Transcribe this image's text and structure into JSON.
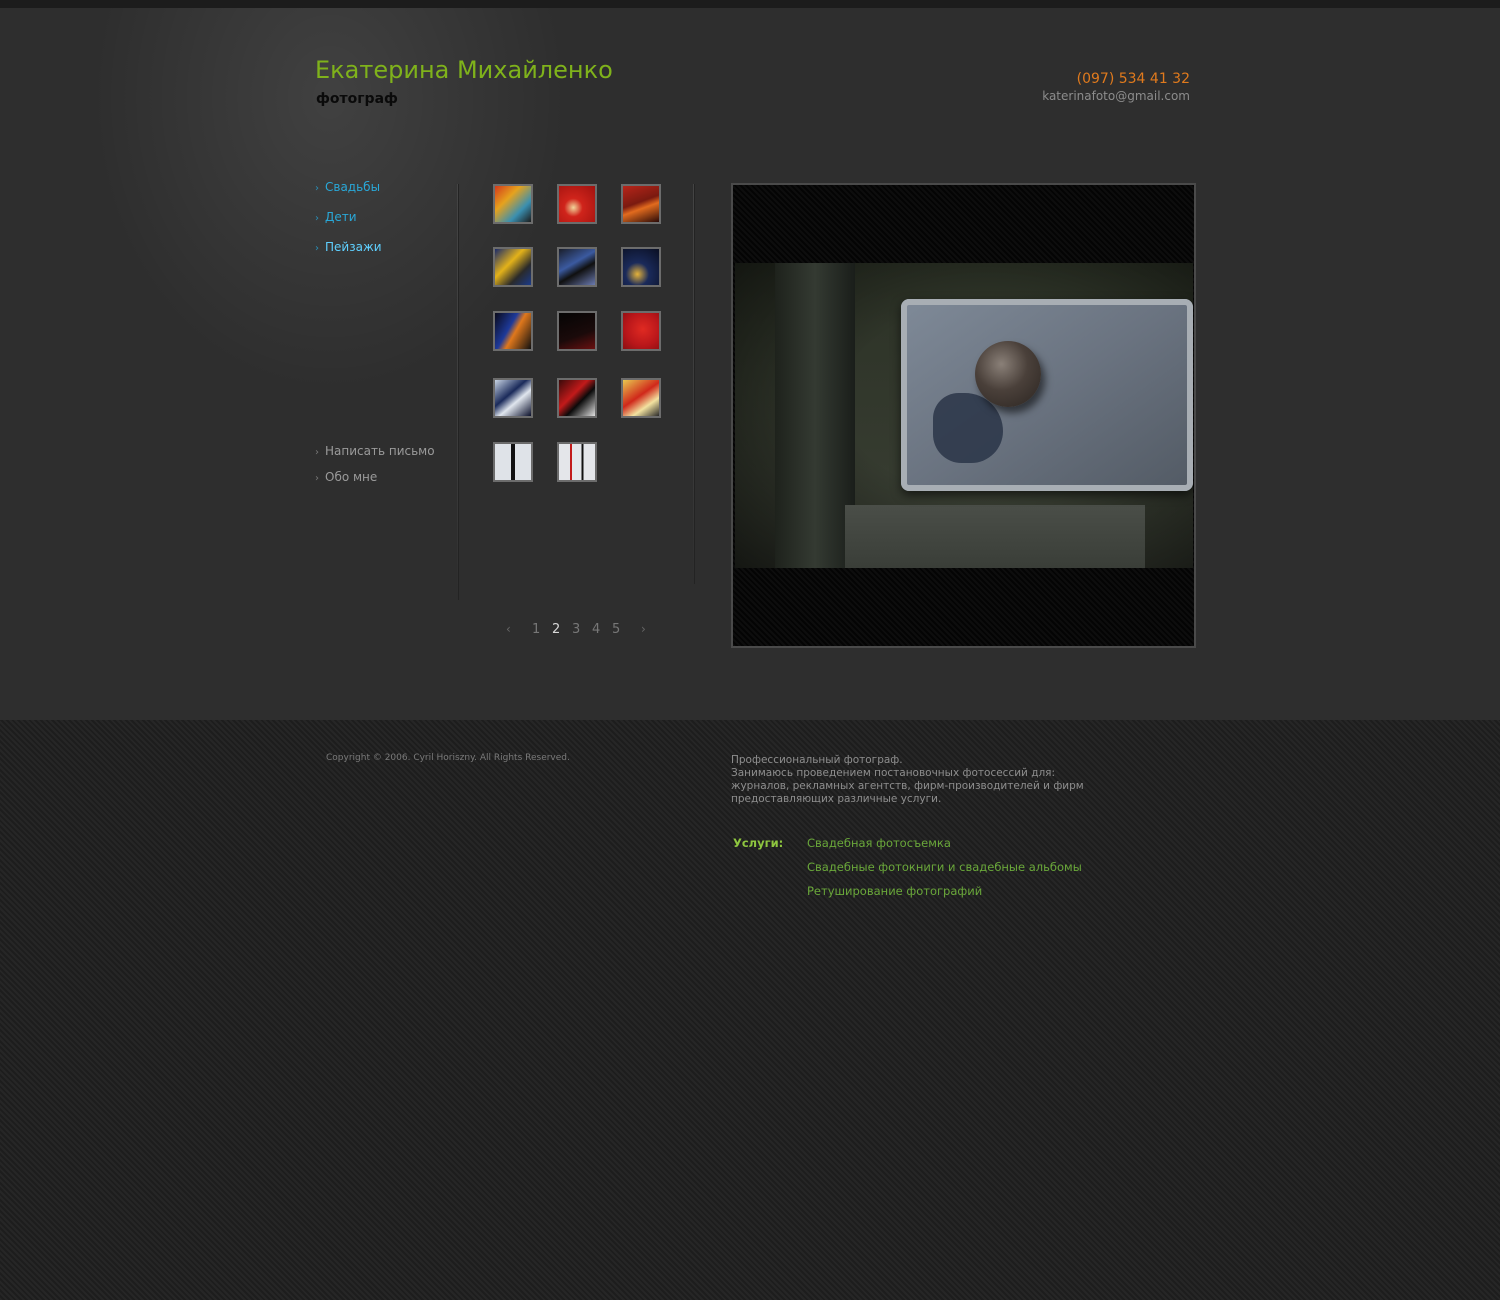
{
  "header": {
    "name": "Екатерина Михайленко",
    "subtitle": "фотограф",
    "phone": "(097) 534 41 32",
    "email": "katerinafoto@gmail.com"
  },
  "nav": {
    "arrow": "›",
    "categories": [
      {
        "label": "Свадьбы"
      },
      {
        "label": "Дети"
      },
      {
        "label": "Пейзажи",
        "active": true
      }
    ],
    "links": [
      {
        "label": "Написать письмо"
      },
      {
        "label": "Обо мне"
      }
    ]
  },
  "gallery": {
    "thumbnail_count": 14,
    "pagination": {
      "prev": "‹",
      "next": "›",
      "pages": [
        "1",
        "2",
        "3",
        "4",
        "5"
      ],
      "current": "2"
    }
  },
  "footer": {
    "copyright": "Copyright © 2006. Cyril Horiszny. All Rights Reserved.",
    "about_line1": "Профессиональный фотограф.",
    "about_line2": "Занимаюсь проведением постановочных фотосессий для: журналов, рекламных агентств, фирм-производителей и фирм предоставляющих различные услуги.",
    "services_label": "Услуги:",
    "services": [
      "Свадебная фотосъемка",
      "Свадебные фотокниги и свадебные альбомы",
      "Ретуширование фотографий"
    ]
  },
  "colors": {
    "brand_green": "#7fb21b",
    "phone_orange": "#e07a1d",
    "nav_blue": "#29a8d8",
    "service_green": "#6aa83a"
  }
}
